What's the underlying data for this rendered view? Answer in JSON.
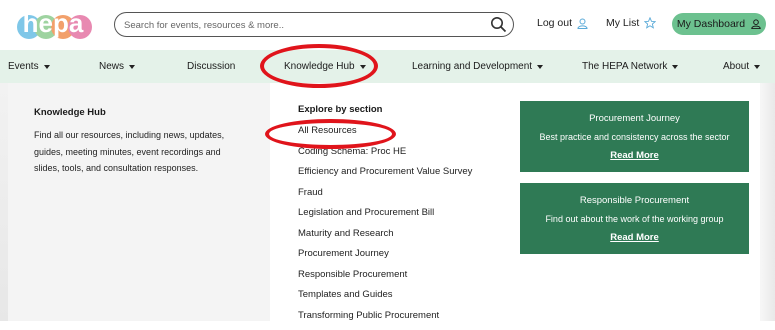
{
  "header": {
    "logo_text": "hepa",
    "search_placeholder": "Search for events, resources & more..",
    "logout_label": "Log out",
    "mylist_label": "My List",
    "dashboard_label": "My Dashboard"
  },
  "nav": {
    "items": [
      {
        "label": "Events",
        "has_caret": true
      },
      {
        "label": "News",
        "has_caret": true
      },
      {
        "label": "Discussion",
        "has_caret": false
      },
      {
        "label": "Knowledge Hub",
        "has_caret": true
      },
      {
        "label": "Learning and Development",
        "has_caret": true
      },
      {
        "label": "The HEPA Network",
        "has_caret": true
      },
      {
        "label": "About",
        "has_caret": true
      }
    ]
  },
  "mega_menu": {
    "title": "Knowledge Hub",
    "description": "Find all our resources, including news, updates, guides, meeting minutes, event recordings and slides, tools, and consultation responses.",
    "explore_title": "Explore by section",
    "sections": [
      "All Resources",
      "Coding Schema: Proc HE",
      "Efficiency and Procurement Value Survey",
      "Fraud",
      "Legislation and Procurement Bill",
      "Maturity and Research",
      "Procurement Journey",
      "Responsible Procurement",
      "Templates and Guides",
      "Transforming Public Procurement"
    ],
    "cards": [
      {
        "title": "Procurement Journey",
        "description": "Best practice and consistency across the sector",
        "link": "Read More"
      },
      {
        "title": "Responsible Procurement",
        "description": "Find out about the work of the working group",
        "link": "Read More"
      }
    ]
  },
  "colors": {
    "accent_green": "#6cc18f",
    "card_green": "#2f7a55",
    "nav_bg": "#e4f2e9",
    "annotation_red": "#e0141b"
  },
  "icons": [
    "search-icon",
    "user-icon",
    "star-icon",
    "caret-down-icon"
  ]
}
